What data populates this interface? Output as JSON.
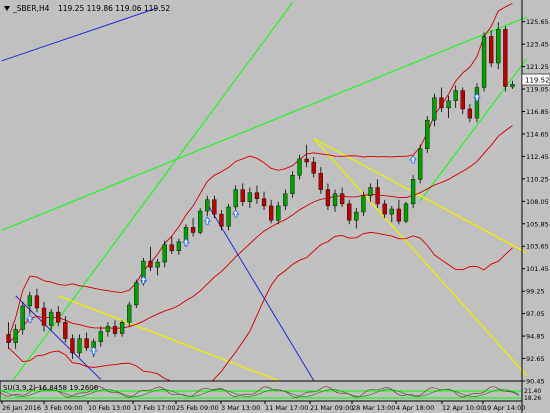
{
  "header": {
    "symbol": "_SBER,H4",
    "ohlc": "119.25 119.86 119.06 119.52"
  },
  "last_price": "119.52",
  "indicator": {
    "label": "SU(3,9,2) 16.8458 19.2606",
    "levels": [
      "21.40",
      "18.26"
    ]
  },
  "colors": {
    "background": "#c0c0c0",
    "bull_candle": "#00a000",
    "bear_candle": "#c00000",
    "bollinger": "#d00000",
    "trend_green": "#33ee33",
    "trend_yellow": "#eeee00",
    "trend_blue": "#2030c8",
    "arrow": "#3070ff",
    "indicator_band": "#00ff00"
  },
  "chart_data": {
    "type": "candlestick",
    "title": "_SBER,H4",
    "y_ticks": [
      "125.65",
      "123.45",
      "121.25",
      "119.05",
      "116.85",
      "114.65",
      "112.45",
      "110.25",
      "108.05",
      "105.85",
      "103.65",
      "101.45",
      "99.25",
      "97.05",
      "94.85",
      "92.65",
      "90.45"
    ],
    "ylim": [
      90.45,
      126.4
    ],
    "x_ticks": [
      "26 Jan 2016",
      "3 Feb 09:00",
      "10 Feb 13:00",
      "17 Feb 17:00",
      "25 Feb 09:00",
      "3 Mar 13:00",
      "11 Mar 17:00",
      "21 Mar 09:00",
      "28 Mar 13:00",
      "4 Apr 18:00",
      "12 Apr 10:00",
      "19 Apr 14:00"
    ],
    "series": [
      {
        "name": "_SBER,H4",
        "values": [
          [
            95.0,
            96.2,
            93.6,
            94.2
          ],
          [
            94.2,
            96.0,
            93.6,
            95.5
          ],
          [
            95.5,
            98.2,
            95.0,
            97.8
          ],
          [
            97.8,
            99.2,
            97.0,
            98.8
          ],
          [
            98.8,
            99.5,
            97.2,
            97.6
          ],
          [
            97.6,
            98.2,
            95.3,
            95.9
          ],
          [
            95.9,
            97.5,
            95.4,
            97.2
          ],
          [
            97.2,
            97.8,
            95.8,
            96.2
          ],
          [
            96.2,
            96.8,
            94.2,
            94.6
          ],
          [
            94.6,
            95.0,
            92.6,
            93.2
          ],
          [
            93.2,
            95.0,
            92.8,
            94.6
          ],
          [
            94.6,
            95.2,
            93.4,
            93.7
          ],
          [
            93.7,
            94.6,
            92.8,
            94.3
          ],
          [
            94.3,
            95.8,
            93.8,
            95.3
          ],
          [
            95.3,
            96.2,
            94.8,
            95.8
          ],
          [
            95.8,
            96.4,
            94.8,
            95.1
          ],
          [
            95.1,
            96.4,
            94.8,
            96.2
          ],
          [
            96.2,
            98.2,
            95.8,
            97.9
          ],
          [
            97.9,
            100.4,
            97.6,
            100.1
          ],
          [
            100.1,
            102.5,
            99.8,
            102.2
          ],
          [
            102.2,
            103.6,
            101.2,
            101.6
          ],
          [
            101.6,
            102.4,
            100.8,
            102.1
          ],
          [
            102.1,
            104.2,
            101.6,
            103.8
          ],
          [
            103.8,
            104.6,
            102.9,
            103.2
          ],
          [
            103.2,
            104.4,
            102.8,
            104.1
          ],
          [
            104.1,
            105.8,
            103.6,
            105.5
          ],
          [
            105.5,
            106.4,
            104.6,
            105.0
          ],
          [
            105.0,
            107.4,
            104.8,
            107.1
          ],
          [
            107.1,
            108.6,
            106.6,
            108.2
          ],
          [
            108.2,
            108.6,
            106.4,
            106.8
          ],
          [
            106.8,
            107.2,
            105.2,
            105.6
          ],
          [
            105.6,
            107.8,
            105.2,
            107.5
          ],
          [
            107.5,
            109.6,
            107.2,
            109.2
          ],
          [
            109.2,
            109.8,
            107.6,
            108.0
          ],
          [
            108.0,
            109.4,
            107.4,
            108.9
          ],
          [
            108.9,
            109.6,
            107.8,
            108.3
          ],
          [
            108.3,
            109.0,
            107.2,
            107.6
          ],
          [
            107.6,
            108.2,
            105.9,
            106.2
          ],
          [
            106.2,
            108.0,
            105.8,
            107.6
          ],
          [
            107.6,
            109.2,
            107.2,
            108.8
          ],
          [
            108.8,
            111.0,
            108.4,
            110.6
          ],
          [
            110.6,
            112.6,
            110.2,
            112.2
          ],
          [
            112.2,
            113.6,
            111.4,
            111.9
          ],
          [
            111.9,
            112.4,
            110.4,
            110.8
          ],
          [
            110.8,
            111.4,
            108.8,
            109.2
          ],
          [
            109.2,
            109.8,
            107.2,
            107.6
          ],
          [
            107.6,
            109.2,
            107.0,
            108.8
          ],
          [
            108.8,
            109.4,
            107.5,
            107.8
          ],
          [
            107.8,
            108.2,
            105.8,
            106.2
          ],
          [
            106.2,
            107.4,
            105.4,
            107.0
          ],
          [
            107.0,
            109.0,
            106.6,
            108.6
          ],
          [
            108.6,
            109.8,
            108.0,
            109.4
          ],
          [
            109.4,
            110.2,
            107.4,
            107.8
          ],
          [
            107.8,
            108.2,
            106.4,
            106.8
          ],
          [
            106.8,
            107.6,
            106.0,
            107.3
          ],
          [
            107.3,
            108.2,
            105.8,
            106.1
          ],
          [
            106.1,
            108.0,
            105.9,
            107.8
          ],
          [
            107.8,
            110.6,
            107.4,
            110.2
          ],
          [
            110.2,
            113.6,
            109.8,
            113.2
          ],
          [
            113.2,
            116.4,
            112.8,
            116.0
          ],
          [
            116.0,
            118.6,
            115.4,
            118.2
          ],
          [
            118.2,
            119.2,
            116.8,
            117.2
          ],
          [
            117.2,
            118.4,
            116.2,
            117.9
          ],
          [
            117.9,
            119.4,
            117.2,
            118.9
          ],
          [
            118.9,
            119.2,
            116.6,
            117.1
          ],
          [
            117.1,
            117.6,
            115.8,
            116.2
          ],
          [
            116.2,
            119.6,
            115.8,
            119.2
          ],
          [
            119.2,
            124.6,
            118.8,
            124.2
          ],
          [
            124.2,
            124.8,
            121.2,
            121.6
          ],
          [
            121.6,
            125.6,
            121.0,
            124.9
          ],
          [
            124.9,
            125.2,
            118.8,
            119.3
          ],
          [
            119.25,
            119.86,
            119.06,
            119.52
          ]
        ]
      }
    ]
  }
}
